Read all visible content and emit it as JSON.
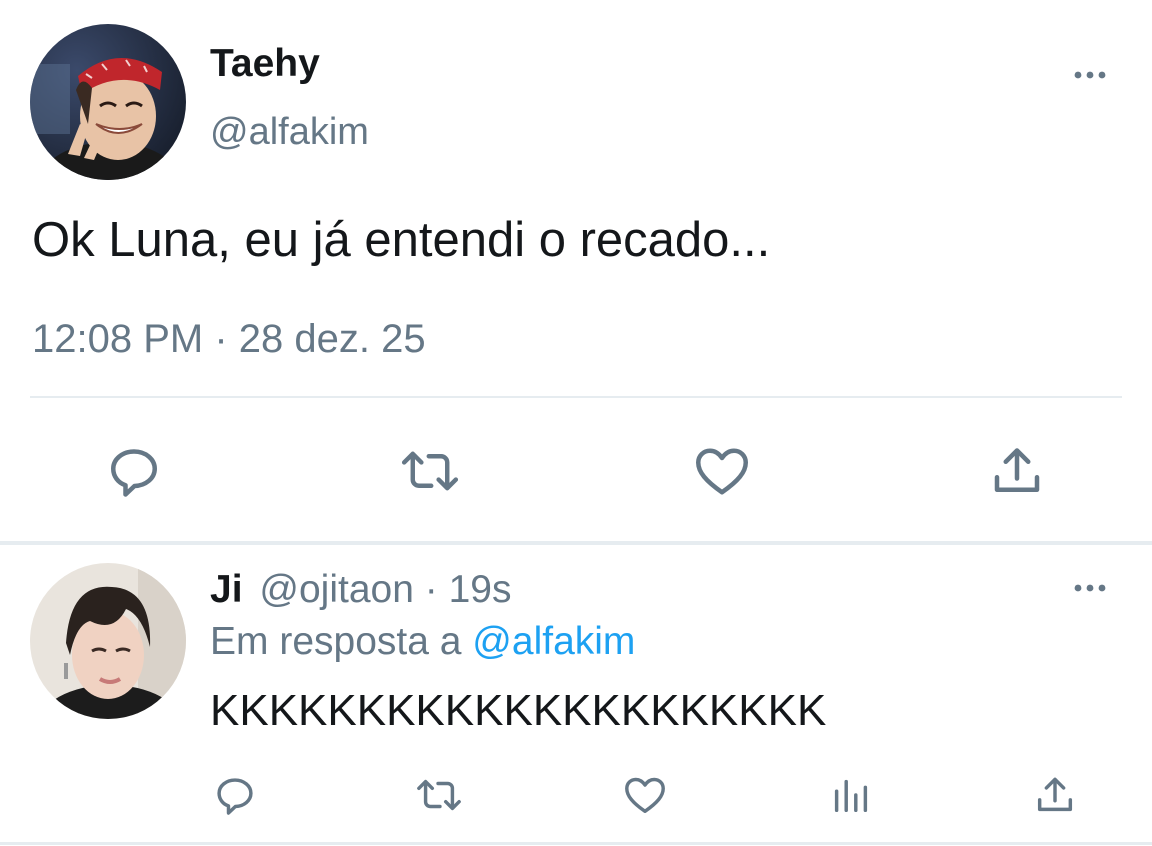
{
  "main_tweet": {
    "display_name": "Taehy",
    "handle": "@alfakim",
    "text": "Ok Luna, eu já entendi o recado...",
    "time": "12:08 PM",
    "separator": "·",
    "date": "28 dez. 25",
    "more_icon": "more-horizontal-icon",
    "actions": [
      "reply-icon",
      "retweet-icon",
      "like-icon",
      "share-icon"
    ]
  },
  "reply_tweet": {
    "display_name": "Ji",
    "handle": "@ojitaon",
    "separator": "·",
    "age": "19s",
    "in_reply_prefix": "Em resposta a",
    "in_reply_handle": "@alfakim",
    "text": "KKKKKKKKKKKKKKKKKKKKK",
    "more_icon": "more-horizontal-icon",
    "actions": [
      "reply-icon",
      "retweet-icon",
      "like-icon",
      "analytics-icon",
      "share-icon"
    ]
  },
  "colors": {
    "text": "#14171a",
    "muted": "#657786",
    "link": "#1da1f2",
    "divider": "#e6ecf0"
  }
}
